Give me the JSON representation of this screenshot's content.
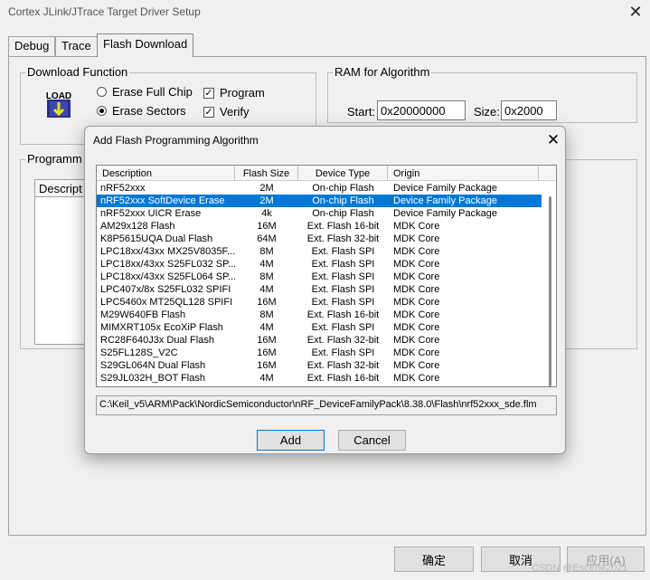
{
  "window": {
    "title": "Cortex JLink/JTrace Target Driver Setup",
    "close_glyph": "✕"
  },
  "tabs": [
    {
      "label": "Debug"
    },
    {
      "label": "Trace"
    },
    {
      "label": "Flash Download"
    }
  ],
  "download_function": {
    "label": "Download Function",
    "icon_text": "LOAD",
    "erase_full_chip": "Erase Full Chip",
    "erase_sectors": "Erase Sectors",
    "erase_selected": "erase-sectors",
    "program": "Program",
    "program_checked": true,
    "verify": "Verify",
    "verify_checked": true
  },
  "ram_for_algorithm": {
    "label": "RAM for Algorithm",
    "start_label": "Start:",
    "start_value": "0x20000000",
    "size_label": "Size:",
    "size_value": "0x2000"
  },
  "programming_group": {
    "label": "Programm",
    "desc_header": "Descript"
  },
  "footer": {
    "ok": "确定",
    "cancel": "取消",
    "apply": "应用(A)",
    "watermark": "CSDN @Escene2021"
  },
  "dialog": {
    "title": "Add Flash Programming Algorithm",
    "close_glyph": "✕",
    "columns": [
      "Description",
      "Flash Size",
      "Device Type",
      "Origin"
    ],
    "selected_index": 1,
    "rows": [
      [
        "nRF52xxx",
        "2M",
        "On-chip Flash",
        "Device Family Package"
      ],
      [
        "nRF52xxx SoftDevice Erase",
        "2M",
        "On-chip Flash",
        "Device Family Package"
      ],
      [
        "nRF52xxx UICR Erase",
        "4k",
        "On-chip Flash",
        "Device Family Package"
      ],
      [
        "AM29x128 Flash",
        "16M",
        "Ext. Flash 16-bit",
        "MDK Core"
      ],
      [
        "K8P5615UQA Dual Flash",
        "64M",
        "Ext. Flash 32-bit",
        "MDK Core"
      ],
      [
        "LPC18xx/43xx MX25V8035F...",
        "8M",
        "Ext. Flash SPI",
        "MDK Core"
      ],
      [
        "LPC18xx/43xx S25FL032 SP...",
        "4M",
        "Ext. Flash SPI",
        "MDK Core"
      ],
      [
        "LPC18xx/43xx S25FL064 SP...",
        "8M",
        "Ext. Flash SPI",
        "MDK Core"
      ],
      [
        "LPC407x/8x S25FL032 SPIFI",
        "4M",
        "Ext. Flash SPI",
        "MDK Core"
      ],
      [
        "LPC5460x MT25QL128 SPIFI",
        "16M",
        "Ext. Flash SPI",
        "MDK Core"
      ],
      [
        "M29W640FB Flash",
        "8M",
        "Ext. Flash 16-bit",
        "MDK Core"
      ],
      [
        "MIMXRT105x EcoXiP Flash",
        "4M",
        "Ext. Flash SPI",
        "MDK Core"
      ],
      [
        "RC28F640J3x Dual Flash",
        "16M",
        "Ext. Flash 32-bit",
        "MDK Core"
      ],
      [
        "S25FL128S_V2C",
        "16M",
        "Ext. Flash SPI",
        "MDK Core"
      ],
      [
        "S29GL064N Dual Flash",
        "16M",
        "Ext. Flash 32-bit",
        "MDK Core"
      ],
      [
        "S29JL032H_BOT Flash",
        "4M",
        "Ext. Flash 16-bit",
        "MDK Core"
      ]
    ],
    "path": "C:\\Keil_v5\\ARM\\Pack\\NordicSemiconductor\\nRF_DeviceFamilyPack\\8.38.0\\Flash\\nrf52xxx_sde.flm",
    "add_label": "Add",
    "cancel_label": "Cancel"
  },
  "colors": {
    "selection": "#0078d7",
    "window_bg": "#f0f0f0",
    "focus_border": "#0078d7"
  }
}
